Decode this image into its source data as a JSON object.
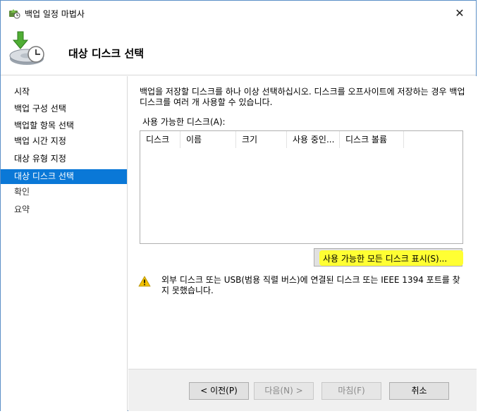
{
  "window": {
    "title": "백업 일정 마법사"
  },
  "header": {
    "title": "대상 디스크 선택"
  },
  "sidebar": {
    "items": [
      {
        "label": "시작"
      },
      {
        "label": "백업 구성 선택"
      },
      {
        "label": "백업할 항목 선택"
      },
      {
        "label": "백업 시간 지정"
      },
      {
        "label": "대상 유형 지정"
      },
      {
        "label": "대상 디스크 선택"
      },
      {
        "label": "확인"
      },
      {
        "label": "요약"
      }
    ],
    "active_index": 5
  },
  "main": {
    "description": "백업을 저장할 디스크를 하나 이상 선택하십시오. 디스크를 오프사이트에 저장하는 경우 백업 디스크를 여러 개 사용할 수 있습니다.",
    "list_label": "사용 가능한 디스크(A):",
    "columns": [
      "디스크",
      "이름",
      "크기",
      "사용 중인...",
      "디스크 볼륨"
    ],
    "rows": [],
    "show_all_button": "사용 가능한 모든 디스크 표시(S)...",
    "warning": "외부 디스크 또는 USB(범용 직렬 버스)에 연결된 디스크 또는 IEEE 1394 포트를 찾지 못했습니다."
  },
  "footer": {
    "prev": "< 이전(P)",
    "next": "다음(N) >",
    "finish": "마침(F)",
    "cancel": "취소"
  },
  "colors": {
    "accent": "#0a78d7",
    "highlight": "#ffff33",
    "warning": "#f2c200"
  },
  "icons": {
    "title": "backup-wizard-icon",
    "header": "backup-disk-icon",
    "warning": "warning-icon",
    "close": "close-icon"
  }
}
